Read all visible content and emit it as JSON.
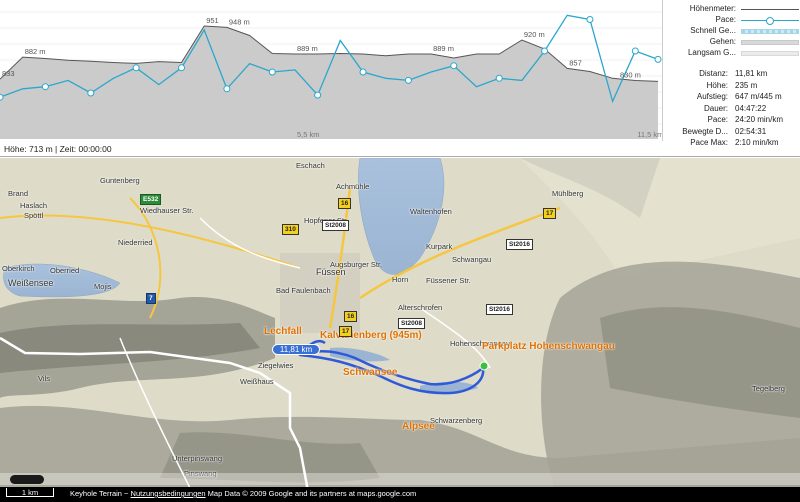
{
  "chart": {
    "elevation_labels": [
      "833",
      "882 m",
      "951",
      "948 m",
      "889 m",
      "889 m",
      "920 m",
      "857",
      "830 m"
    ],
    "xaxis_labels": [
      "5,5 km",
      "11,5 km"
    ],
    "colors": {
      "elevation": "#555555",
      "pace": "#2aa7cc",
      "fill": "#c9c9c9"
    }
  },
  "chart_data": {
    "type": "line",
    "x": [
      0,
      0.4,
      0.8,
      1.2,
      1.6,
      2.0,
      2.4,
      2.8,
      3.2,
      3.6,
      4.0,
      4.4,
      4.8,
      5.2,
      5.6,
      6.0,
      6.4,
      6.8,
      7.2,
      7.6,
      8.0,
      8.4,
      8.8,
      9.2,
      9.6,
      10.0,
      10.4,
      10.8,
      11.2,
      11.6
    ],
    "series": [
      {
        "values": [
          833,
          882,
          879,
          875,
          873,
          870,
          868,
          872,
          870,
          951,
          948,
          930,
          890,
          889,
          889,
          890,
          889,
          885,
          889,
          889,
          880,
          889,
          889,
          920,
          900,
          857,
          850,
          835,
          830,
          828
        ]
      },
      {
        "values": [
          8,
          12,
          13,
          16,
          10,
          17,
          22,
          14,
          22,
          40,
          12,
          24,
          20,
          21,
          9,
          35,
          20,
          17,
          16,
          20,
          23,
          13,
          17,
          16,
          30,
          47,
          45,
          6,
          30,
          26
        ]
      }
    ],
    "xlabel": "",
    "ylabel": ""
  },
  "status": {
    "text": "Höhe: 713 m | Zeit: 00:00:00"
  },
  "legend": {
    "items": [
      {
        "label": "Höhenmeter:",
        "style": "line"
      },
      {
        "label": "Pace:",
        "style": "pace"
      },
      {
        "label": "Schnell Ge...",
        "style": "fast"
      },
      {
        "label": "Gehen:",
        "style": "walk"
      },
      {
        "label": "Langsam G...",
        "style": "slow"
      }
    ]
  },
  "stats": [
    {
      "label": "Distanz:",
      "value": "11,81 km"
    },
    {
      "label": "Höhe:",
      "value": "235 m"
    },
    {
      "label": "Aufstieg:",
      "value": "647 m/445 m"
    },
    {
      "label": "Dauer:",
      "value": "04:47:22"
    },
    {
      "label": "Pace:",
      "value": "24:20 min/km"
    },
    {
      "label": "Bewegte D...",
      "value": "02:54:31"
    },
    {
      "label": "Pace Max:",
      "value": "2:10 min/km"
    }
  ],
  "map": {
    "distance_badge": "11,81 km",
    "pois": [
      "Lechfall",
      "Kalvarienberg (945m)",
      "Schwansee",
      "Parkplatz Hohenschwangau",
      "Alpsee"
    ],
    "places": [
      "Eschach",
      "Achmühle",
      "Mühlberg",
      "Waltenhofen",
      "Brand",
      "Haslach",
      "Spöttl",
      "Guntenberg",
      "Niederried",
      "Kurpark",
      "Schwangau",
      "Horn",
      "Oberkirch",
      "Oberried",
      "Weißensee",
      "Mojis",
      "Füssen",
      "Bad Faulenbach",
      "Alterschrofen",
      "Hohenschwangau",
      "Ziegelwies",
      "Weißhaus",
      "Vils",
      "Unterpinswang",
      "Pinswang",
      "Schwarzenberg",
      "Tegelberg",
      "Hopfener Str.",
      "Füssener Str.",
      "Augsburger Str.",
      "Wiedhauser Str."
    ],
    "roads": [
      "E532",
      "16",
      "310",
      "St2008",
      "17",
      "St2016",
      "7",
      "16",
      "17",
      "St2008",
      "St2016"
    ]
  },
  "footer": {
    "scale": "1 km",
    "attribution_pre": "Keyhole Terrain ~ ",
    "tos_link": "Nutzungsbedingungen",
    "attribution_post": " Map Data © 2009 Google and its partners at maps.google.com"
  }
}
